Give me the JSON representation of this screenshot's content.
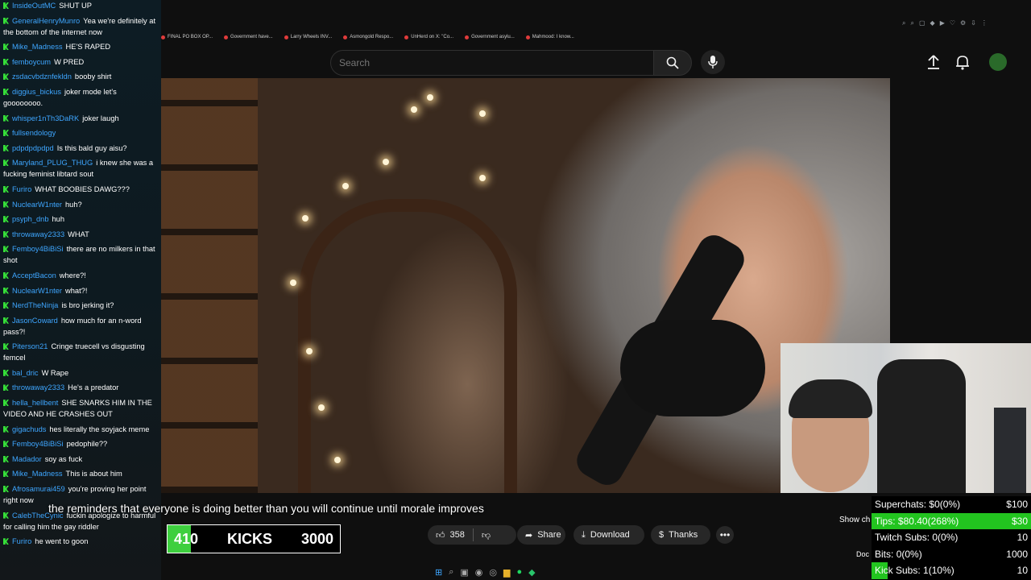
{
  "bookmarks": [
    "FINAL PO BOX OP...",
    "Government have...",
    "Larry Wheels INV...",
    "Asmongold Respo...",
    "UnHerd on X: \"Co...",
    "Government asylu...",
    "Mahmood: I know..."
  ],
  "search": {
    "placeholder": "Search"
  },
  "video": {
    "caption": "the reminders that everyone is doing better than you will continue until morale improves",
    "likes": "358",
    "share_label": "Share",
    "download_label": "Download",
    "thanks_label": "Thanks",
    "show_chat_label": "Show ch",
    "doc_label": "Doc"
  },
  "kicks": {
    "current": "410",
    "label": "KICKS",
    "goal": "3000",
    "progress": 0.137
  },
  "stats": [
    {
      "label": "Superchats:",
      "value": "$0(0%)",
      "goal": "$100"
    },
    {
      "label": "Tips:",
      "value": "$80.40(268%)",
      "goal": "$30",
      "progress": 1.0
    },
    {
      "label": "Twitch Subs:",
      "value": "0(0%)",
      "goal": "10"
    },
    {
      "label": "Bits:",
      "value": "0(0%)",
      "goal": "1000"
    },
    {
      "label": "Kick Subs:",
      "value": "1(10%)",
      "goal": "10",
      "progress": 0.1
    }
  ],
  "chat": [
    {
      "user": "InsideOutMC",
      "text": "SHUT UP"
    },
    {
      "user": "GeneralHenryMunro",
      "text": "Yea we're definitely at the bottom of the internet now"
    },
    {
      "user": "Mike_Madness",
      "text": "HE'S RAPED"
    },
    {
      "user": "femboycum",
      "text": "W PRED"
    },
    {
      "user": "zsdacvbdznfekldn",
      "text": "booby shirt"
    },
    {
      "user": "diggius_bickus",
      "text": "joker mode let's goooooooo."
    },
    {
      "user": "whisper1nTh3DaRK",
      "text": "joker laugh"
    },
    {
      "user": "fullsendology",
      "text": ""
    },
    {
      "user": "pdpdpdpdpd",
      "text": "Is this bald guy aisu?"
    },
    {
      "user": "Maryland_PLUG_THUG",
      "text": "i knew she was a fucking feminist libtard sout"
    },
    {
      "user": "Furiro",
      "text": "WHAT BOOBIES DAWG???"
    },
    {
      "user": "NuclearW1nter",
      "text": "huh?"
    },
    {
      "user": "psyph_dnb",
      "text": "huh"
    },
    {
      "user": "throwaway2333",
      "text": "WHAT"
    },
    {
      "user": "Femboy4BiBiSi",
      "text": "there are no milkers in that shot"
    },
    {
      "user": "AcceptBacon",
      "text": "where?!"
    },
    {
      "user": "NuclearW1nter",
      "text": "what?!"
    },
    {
      "user": "NerdTheNinja",
      "text": "is bro jerking it?"
    },
    {
      "user": "JasonCoward",
      "text": "how much for an n-word pass?!"
    },
    {
      "user": "Piterson21",
      "text": "Cringe truecell vs disgusting femcel"
    },
    {
      "user": "bal_dric",
      "text": "W Rape"
    },
    {
      "user": "throwaway2333",
      "text": "He's a predator"
    },
    {
      "user": "hella_hellbent",
      "text": "SHE SNARKS HIM IN THE VIDEO AND HE CRASHES OUT"
    },
    {
      "user": "gigachuds",
      "text": "hes literally the soyjack meme"
    },
    {
      "user": "Femboy4BiBiSi",
      "text": "pedophile??"
    },
    {
      "user": "Madador",
      "text": "soy as fuck"
    },
    {
      "user": "Mike_Madness",
      "text": "This is about him"
    },
    {
      "user": "Afrosamurai459",
      "text": "you're proving her point right now"
    },
    {
      "user": "CalebTheCynic",
      "text": "fuckin apologize to harmful for calling him the gay riddler"
    },
    {
      "user": "Furiro",
      "text": "he went to goon"
    }
  ],
  "colors": {
    "kick_green": "#36e039",
    "username_blue": "#3ea6ff",
    "youtube_bg": "#0f0f0f"
  }
}
